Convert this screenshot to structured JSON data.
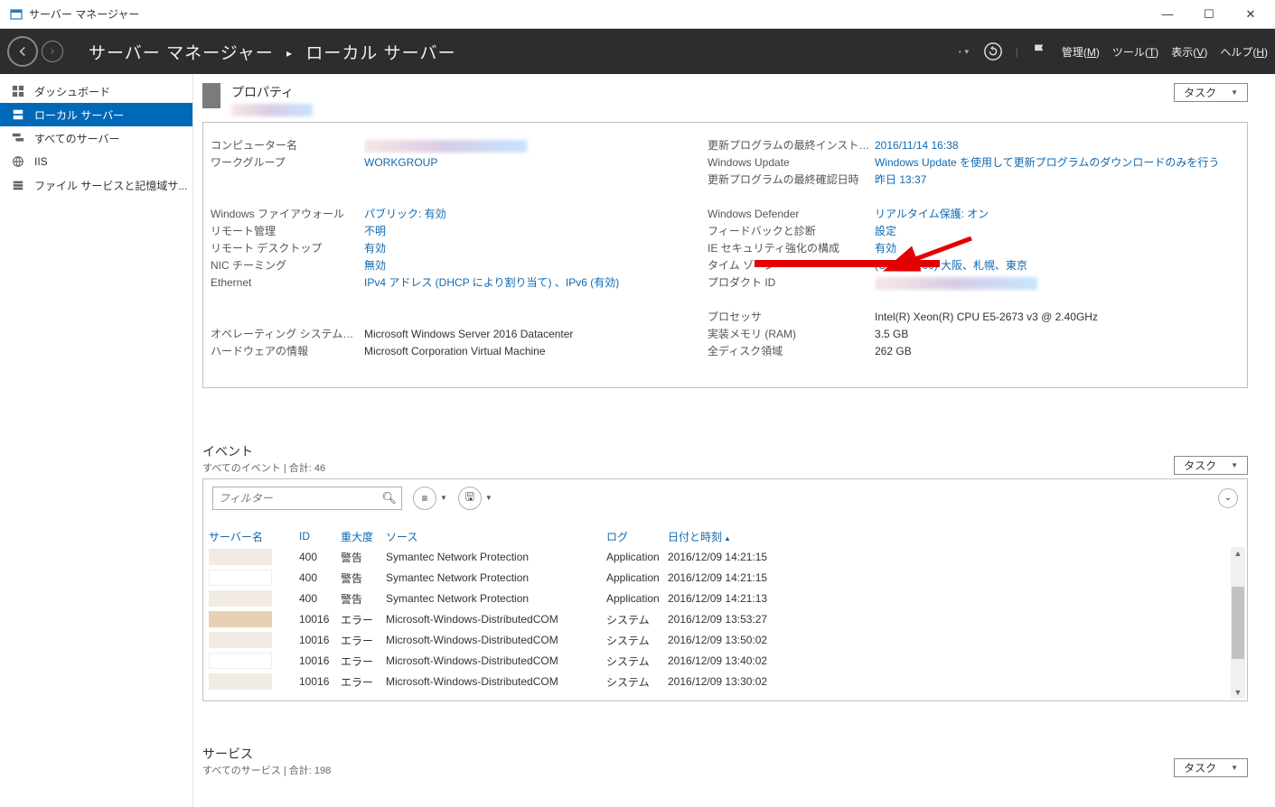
{
  "window": {
    "title": "サーバー マネージャー"
  },
  "header": {
    "breadcrumb_root": "サーバー マネージャー",
    "breadcrumb_leaf": "ローカル サーバー",
    "menu": {
      "manage": "管理",
      "manage_k": "M",
      "tools": "ツール",
      "tools_k": "T",
      "view": "表示",
      "view_k": "V",
      "help": "ヘルプ",
      "help_k": "H"
    }
  },
  "sidebar": {
    "items": [
      {
        "label": "ダッシュボード"
      },
      {
        "label": "ローカル サーバー"
      },
      {
        "label": "すべてのサーバー"
      },
      {
        "label": "IIS"
      },
      {
        "label": "ファイル サービスと記憶域サ..."
      }
    ]
  },
  "props": {
    "title": "プロパティ",
    "task_label": "タスク",
    "left": [
      {
        "label": "コンピューター名",
        "value": "",
        "link": true,
        "redacted": true
      },
      {
        "label": "ワークグループ",
        "value": "WORKGROUP",
        "link": true
      },
      {
        "spacer": true
      },
      {
        "label": "Windows ファイアウォール",
        "value": "パブリック: 有効",
        "link": true
      },
      {
        "label": "リモート管理",
        "value": "不明",
        "link": true
      },
      {
        "label": "リモート デスクトップ",
        "value": "有効",
        "link": true
      },
      {
        "label": "NIC チーミング",
        "value": "無効",
        "link": true
      },
      {
        "label": "Ethernet",
        "value": "IPv4 アドレス (DHCP により割り当て) 、IPv6 (有効)",
        "link": true
      },
      {
        "spacer": true
      },
      {
        "label": "オペレーティング システムのバージョン",
        "value": "Microsoft Windows Server 2016 Datacenter",
        "link": false
      },
      {
        "label": "ハードウェアの情報",
        "value": "Microsoft Corporation Virtual Machine",
        "link": false
      }
    ],
    "right": [
      {
        "label": "更新プログラムの最終インストール日時",
        "value": "2016/11/14 16:38",
        "link": true
      },
      {
        "label": "Windows Update",
        "value": "Windows Update を使用して更新プログラムのダウンロードのみを行う",
        "link": true
      },
      {
        "label": "更新プログラムの最終確認日時",
        "value": "昨日 13:37",
        "link": true
      },
      {
        "spacer": true,
        "h": 19
      },
      {
        "label": "Windows Defender",
        "value": "リアルタイム保護: オン",
        "link": true
      },
      {
        "label": "フィードバックと診断",
        "value": "設定",
        "link": true
      },
      {
        "label": "IE セキュリティ強化の構成",
        "value": "有効",
        "link": true
      },
      {
        "label": "タイム ゾーン",
        "value": "(UTC+09:00) 大阪、札幌、東京",
        "link": true
      },
      {
        "label": "プロダクト ID",
        "value": "",
        "link": true,
        "redacted": true
      },
      {
        "spacer": true,
        "h": 19
      },
      {
        "label": "プロセッサ",
        "value": "Intel(R) Xeon(R) CPU E5-2673 v3 @ 2.40GHz",
        "link": false
      },
      {
        "label": "実装メモリ (RAM)",
        "value": "3.5 GB",
        "link": false
      },
      {
        "label": "全ディスク領域",
        "value": "262 GB",
        "link": false
      }
    ]
  },
  "events": {
    "title": "イベント",
    "subtitle": "すべてのイベント | 合計: 46",
    "task_label": "タスク",
    "filter_placeholder": "フィルター",
    "columns": {
      "server": "サーバー名",
      "id": "ID",
      "sev": "重大度",
      "src": "ソース",
      "log": "ログ",
      "date": "日付と時刻"
    },
    "rows": [
      {
        "id": "400",
        "sev": "警告",
        "src": "Symantec Network Protection",
        "log": "Application",
        "date": "2016/12/09 14:21:15"
      },
      {
        "id": "400",
        "sev": "警告",
        "src": "Symantec Network Protection",
        "log": "Application",
        "date": "2016/12/09 14:21:15"
      },
      {
        "id": "400",
        "sev": "警告",
        "src": "Symantec Network Protection",
        "log": "Application",
        "date": "2016/12/09 14:21:13"
      },
      {
        "id": "10016",
        "sev": "エラー",
        "src": "Microsoft-Windows-DistributedCOM",
        "log": "システム",
        "date": "2016/12/09 13:53:27"
      },
      {
        "id": "10016",
        "sev": "エラー",
        "src": "Microsoft-Windows-DistributedCOM",
        "log": "システム",
        "date": "2016/12/09 13:50:02"
      },
      {
        "id": "10016",
        "sev": "エラー",
        "src": "Microsoft-Windows-DistributedCOM",
        "log": "システム",
        "date": "2016/12/09 13:40:02"
      },
      {
        "id": "10016",
        "sev": "エラー",
        "src": "Microsoft-Windows-DistributedCOM",
        "log": "システム",
        "date": "2016/12/09 13:30:02"
      }
    ]
  },
  "services": {
    "title": "サービス",
    "subtitle": "すべてのサービス | 合計: 198",
    "task_label": "タスク"
  }
}
